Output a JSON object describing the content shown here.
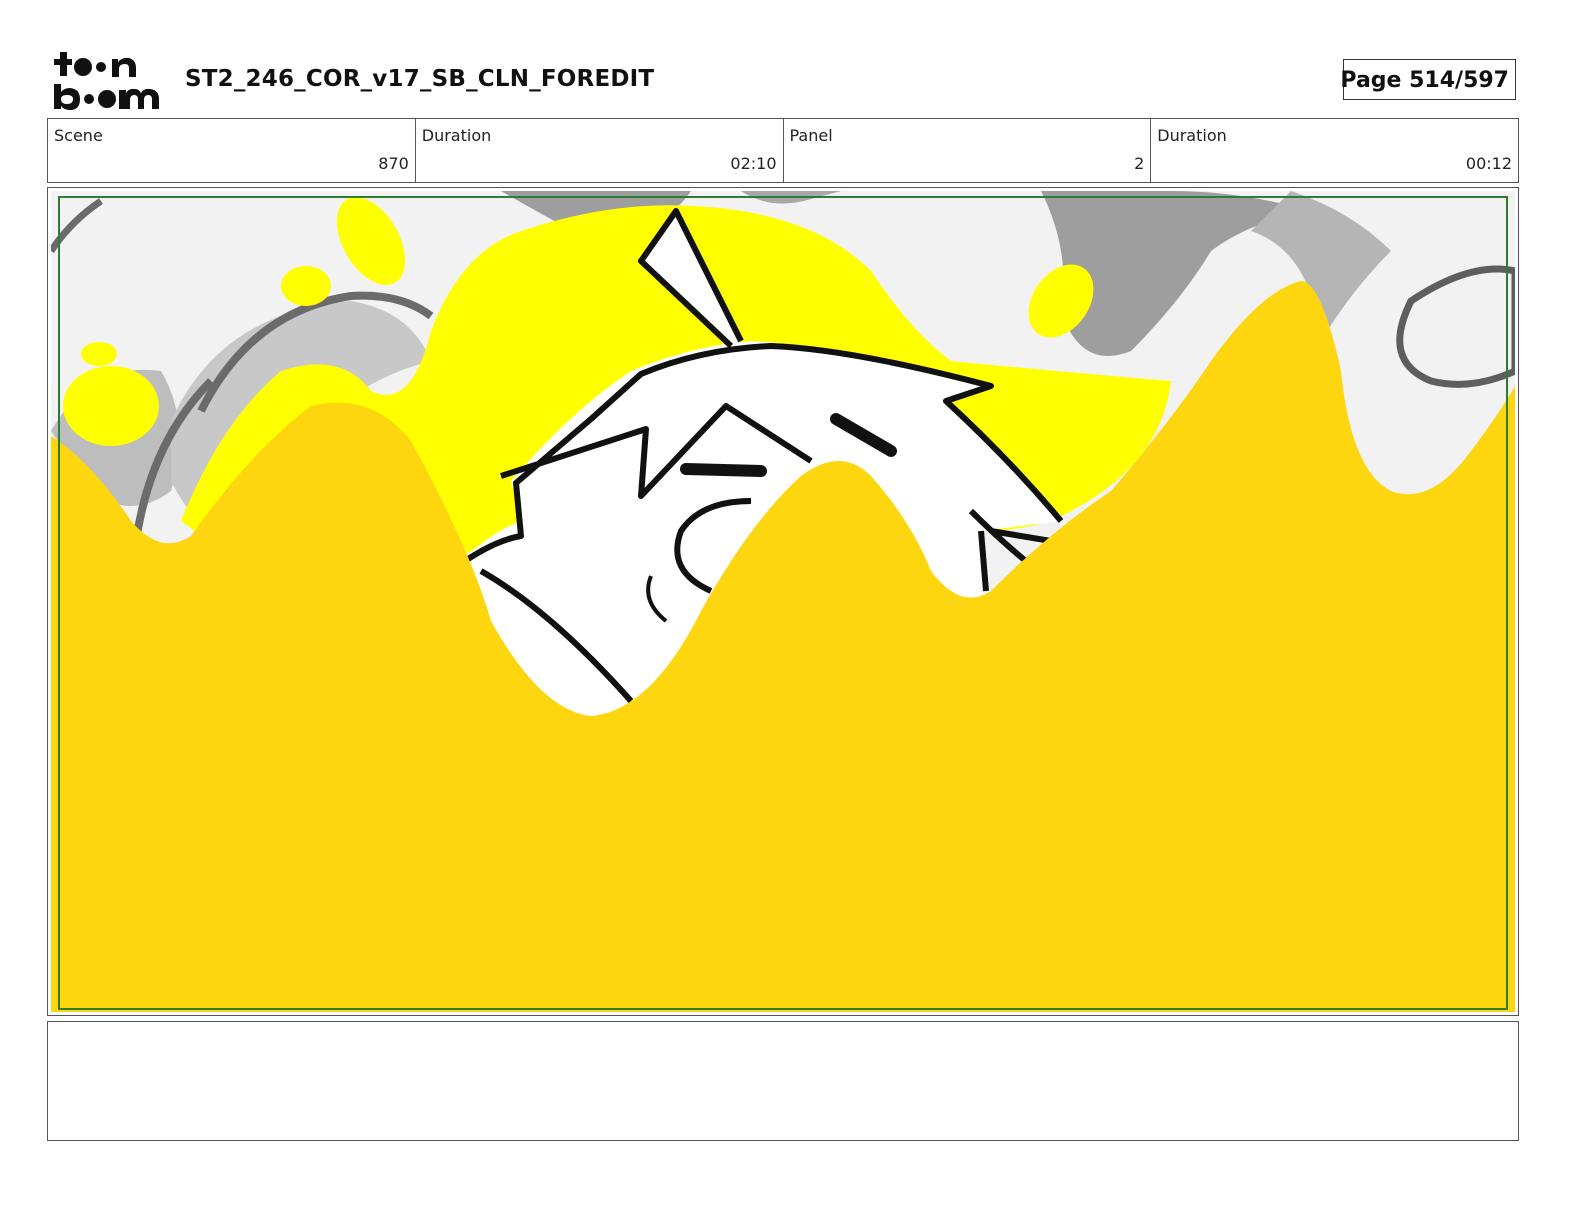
{
  "header": {
    "logo_text": "toonboom",
    "document_title": "ST2_246_COR_v17_SB_CLN_FOREDIT",
    "page_label": "Page 514/597"
  },
  "info": {
    "scene_label": "Scene",
    "scene_value": "870",
    "scene_duration_label": "Duration",
    "scene_duration_value": "02:10",
    "panel_label": "Panel",
    "panel_value": "2",
    "panel_duration_label": "Duration",
    "panel_duration_value": "00:12"
  },
  "panel": {
    "safe_frame_color": "#2e7d32",
    "liquid_color": "#fdd60f",
    "splash_color": "#ffff00"
  },
  "notes": {
    "text": ""
  }
}
